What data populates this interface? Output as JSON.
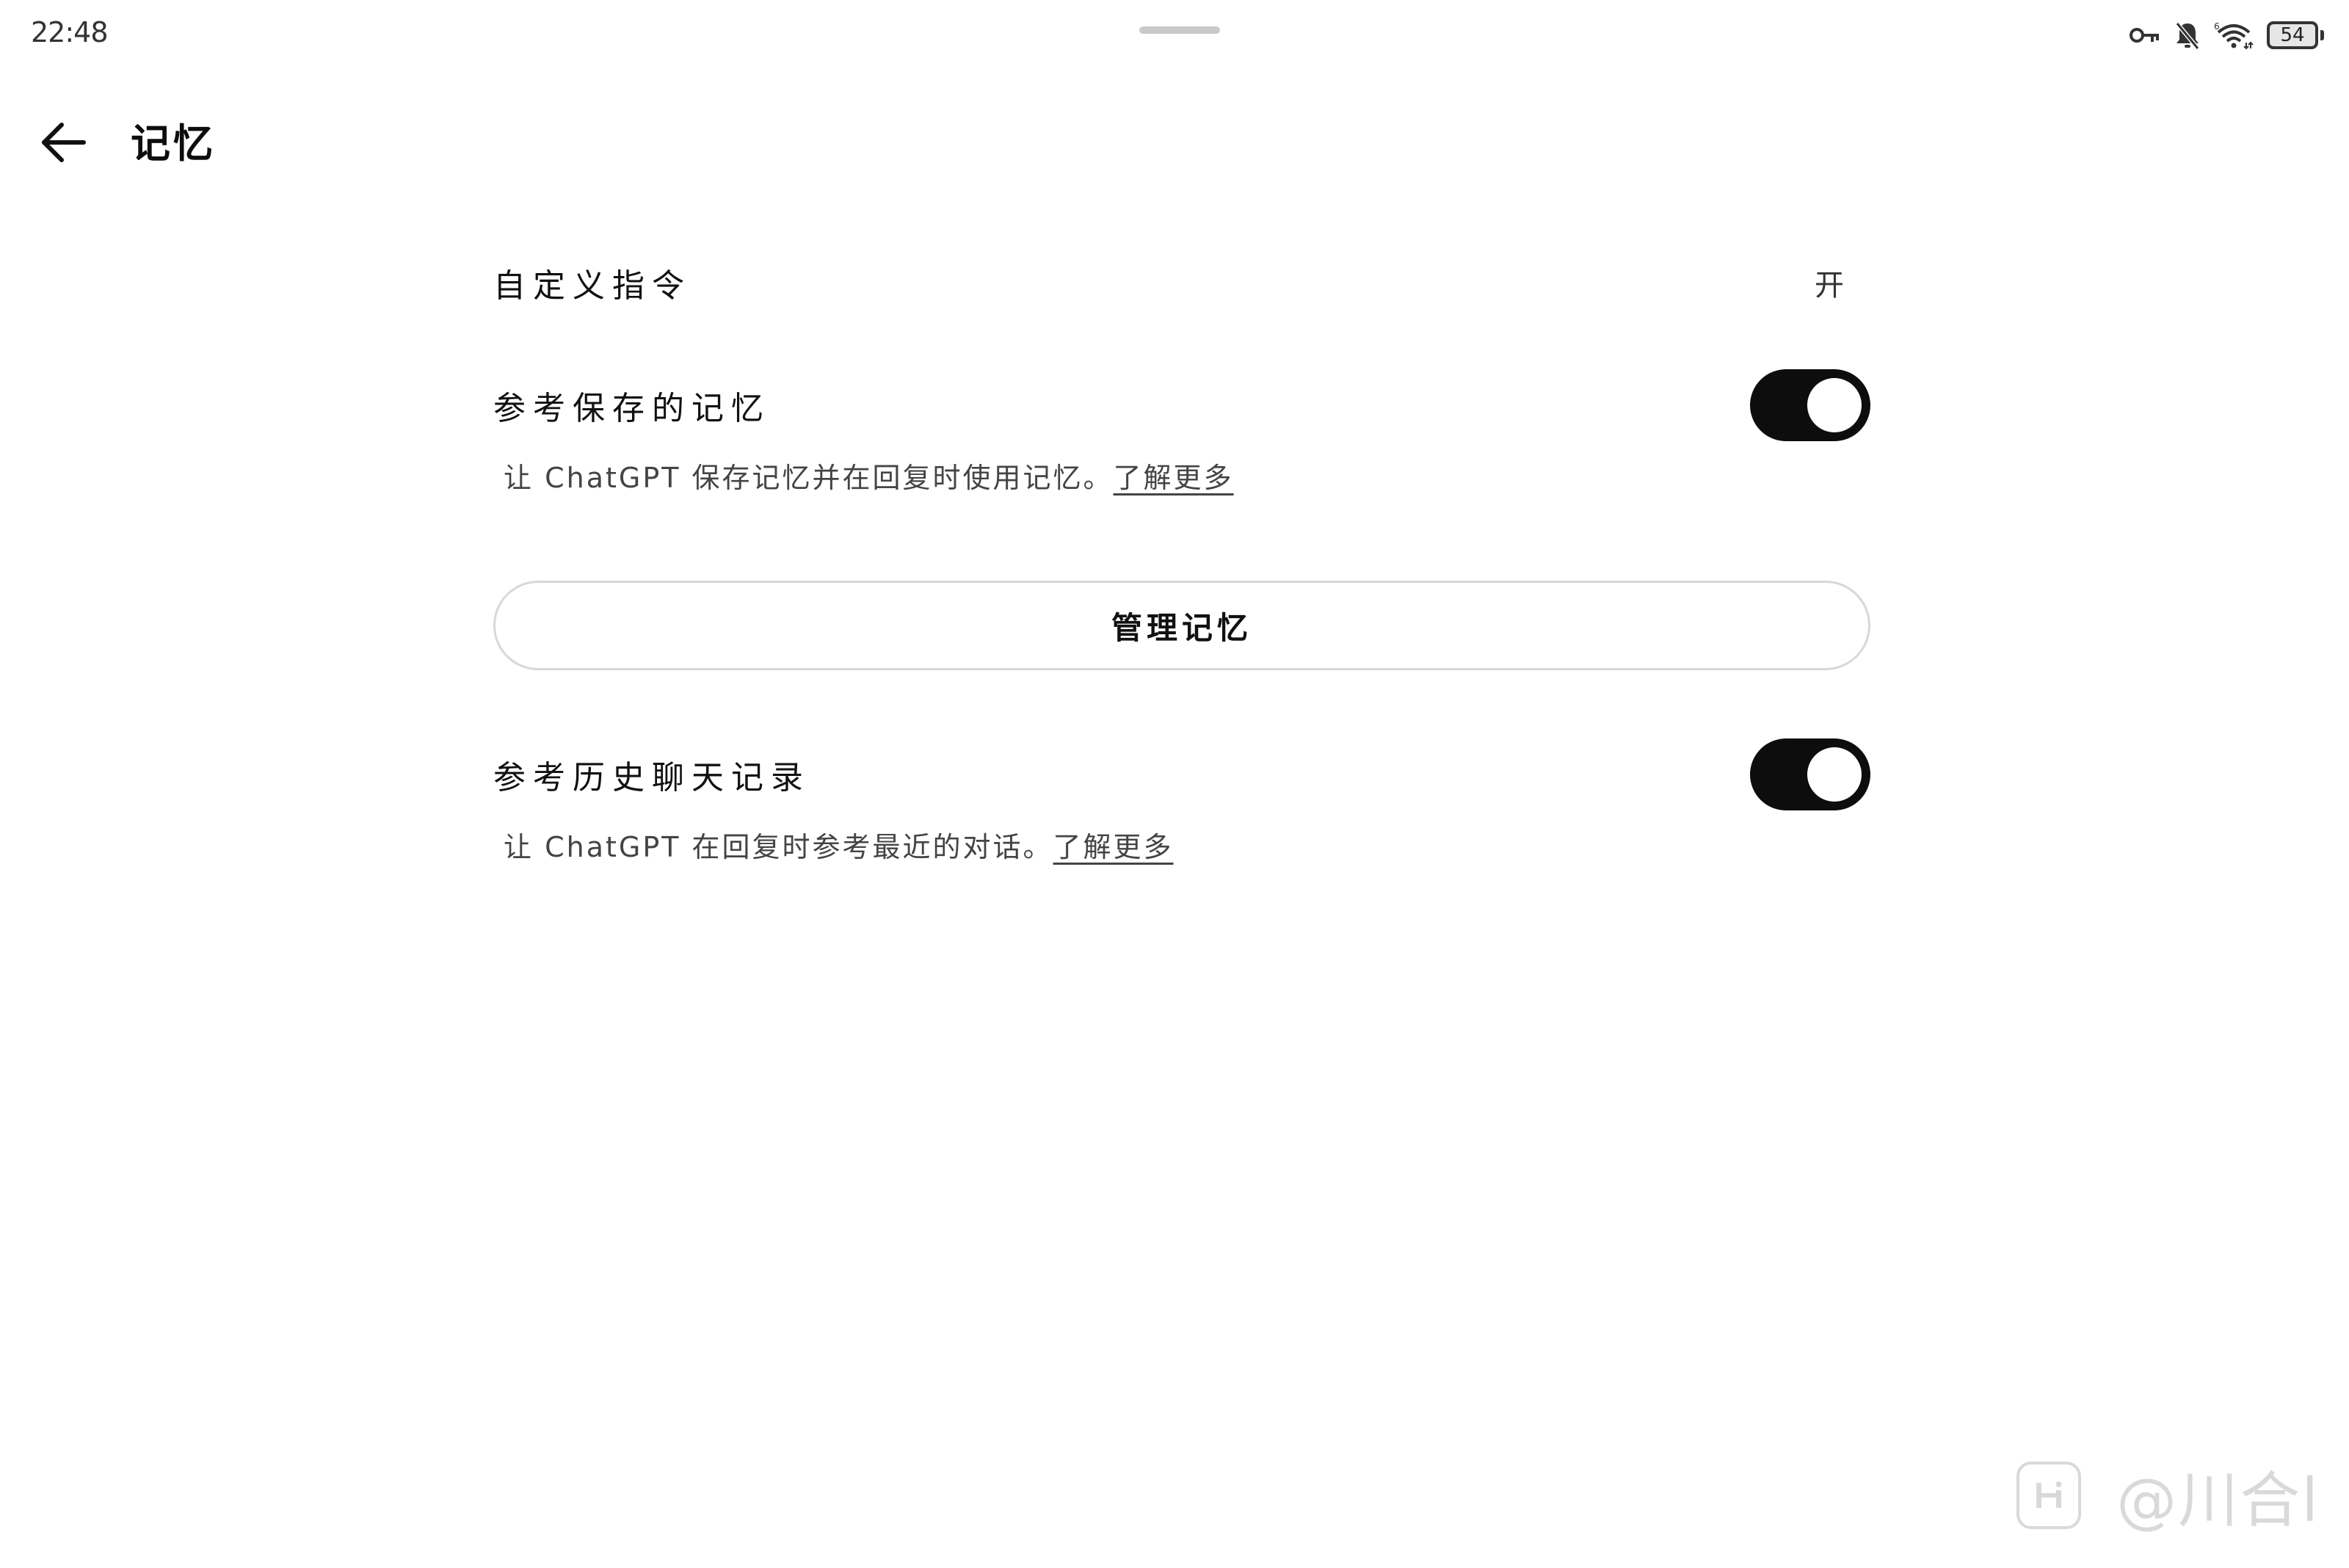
{
  "status_bar": {
    "time": "22:48",
    "battery": "54",
    "icons": [
      "vpn-key-icon",
      "bell-off-icon",
      "wifi-icon",
      "battery-icon"
    ]
  },
  "header": {
    "back_icon": "arrow-left-icon",
    "title": "记忆"
  },
  "settings": {
    "custom_instructions": {
      "label": "自定义指令",
      "value": "开"
    },
    "saved_memories": {
      "label": "参考保存的记忆",
      "enabled": true,
      "description": "让 ChatGPT 保存记忆并在回复时使用记忆。",
      "learn_more": "了解更多"
    },
    "manage_button": "管理记忆",
    "chat_history": {
      "label": "参考历史聊天记录",
      "enabled": true,
      "description": "让 ChatGPT 在回复时参考最近的对话。",
      "learn_more": "了解更多"
    }
  },
  "watermark": {
    "text": "@川合l"
  },
  "colors": {
    "toggle_on": "#0d0d0d",
    "background": "#ffffff",
    "button_border": "#d8d8d8"
  }
}
